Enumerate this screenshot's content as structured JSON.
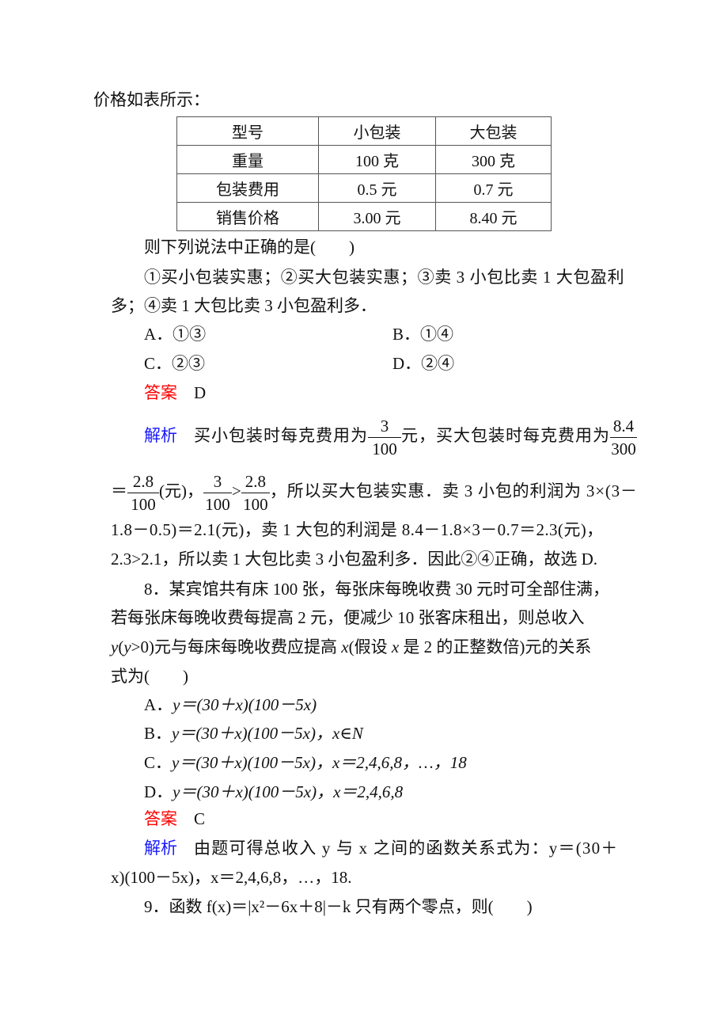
{
  "intro": "价格如表所示：",
  "table": {
    "header": [
      "型号",
      "小包装",
      "大包装"
    ],
    "rows": [
      [
        "重量",
        "100 克",
        "300 克"
      ],
      [
        "包装费用",
        "0.5 元",
        "0.7 元"
      ],
      [
        "销售价格",
        "3.00 元",
        "8.40 元"
      ]
    ]
  },
  "q7": {
    "stem": "则下列说法中正确的是(　　)",
    "statements_line1": "①买小包装实惠；②买大包装实惠；③卖 3 小包比卖 1 大包盈利",
    "statements_line2": "多；④卖 1 大包比卖 3 小包盈利多．",
    "options": [
      {
        "label": "A．",
        "text": "①③"
      },
      {
        "label": "B．",
        "text": "①④"
      },
      {
        "label": "C．",
        "text": "②③"
      },
      {
        "label": "D．",
        "text": "②④"
      }
    ],
    "answer_label": "答案",
    "answer": "D",
    "analysis_label": "解析",
    "analysis": {
      "l1a": "买小包装时每克费用为",
      "f1_num": "3",
      "f1_den": "100",
      "l1b": "元，买大包装时每克费用为",
      "f2_num": "8.4",
      "f2_den": "300",
      "l2a": "＝",
      "f3_num": "2.8",
      "f3_den": "100",
      "l2b": "(元)，",
      "f4_num": "3",
      "f4_den": "100",
      "l2c": ">",
      "f5_num": "2.8",
      "f5_den": "100",
      "l2d": "，所以买大包装实惠．卖 3 小包的利润为 3×(3－",
      "l3": "1.8－0.5)＝2.1(元)，卖 1 大包的利润是 8.4－1.8×3－0.7＝2.3(元)，",
      "l4": "2.3>2.1，所以卖 1 大包比卖 3 小包盈利多．因此②④正确，故选 D."
    }
  },
  "q8": {
    "l1": "8．某宾馆共有床 100 张，每张床每晚收费 30 元时可全部住满，",
    "l2": "若每张床每晚收费每提高 2 元，便减少 10 张客床租出，则总收入",
    "l3a": "y",
    "l3b": "(",
    "l3c": "y",
    "l3d": ">0)元与每床每晚收费应提高 ",
    "l3e": "x",
    "l3f": "(假设 ",
    "l3g": "x",
    "l3h": " 是 2 的正整数倍)元的关系",
    "l4": "式为(　　)",
    "options": [
      {
        "label": "A．",
        "text": "y＝(30＋x)(100－5x)"
      },
      {
        "label": "B．",
        "text": "y＝(30＋x)(100－5x)，x∈N"
      },
      {
        "label": "C．",
        "text": "y＝(30＋x)(100－5x)，x＝2,4,6,8，…，18"
      },
      {
        "label": "D．",
        "text": "y＝(30＋x)(100－5x)，x＝2,4,6,8"
      }
    ],
    "answer_label": "答案",
    "answer": "C",
    "analysis_label": "解析",
    "analysis_l1": "由题可得总收入 y 与 x 之间的函数关系式为：y＝(30＋",
    "analysis_l2": "x)(100－5x)，x＝2,4,6,8，…，18."
  },
  "q9": {
    "stem": "9．函数 f(x)＝|x²－6x＋8|－k 只有两个零点，则(　　)"
  }
}
